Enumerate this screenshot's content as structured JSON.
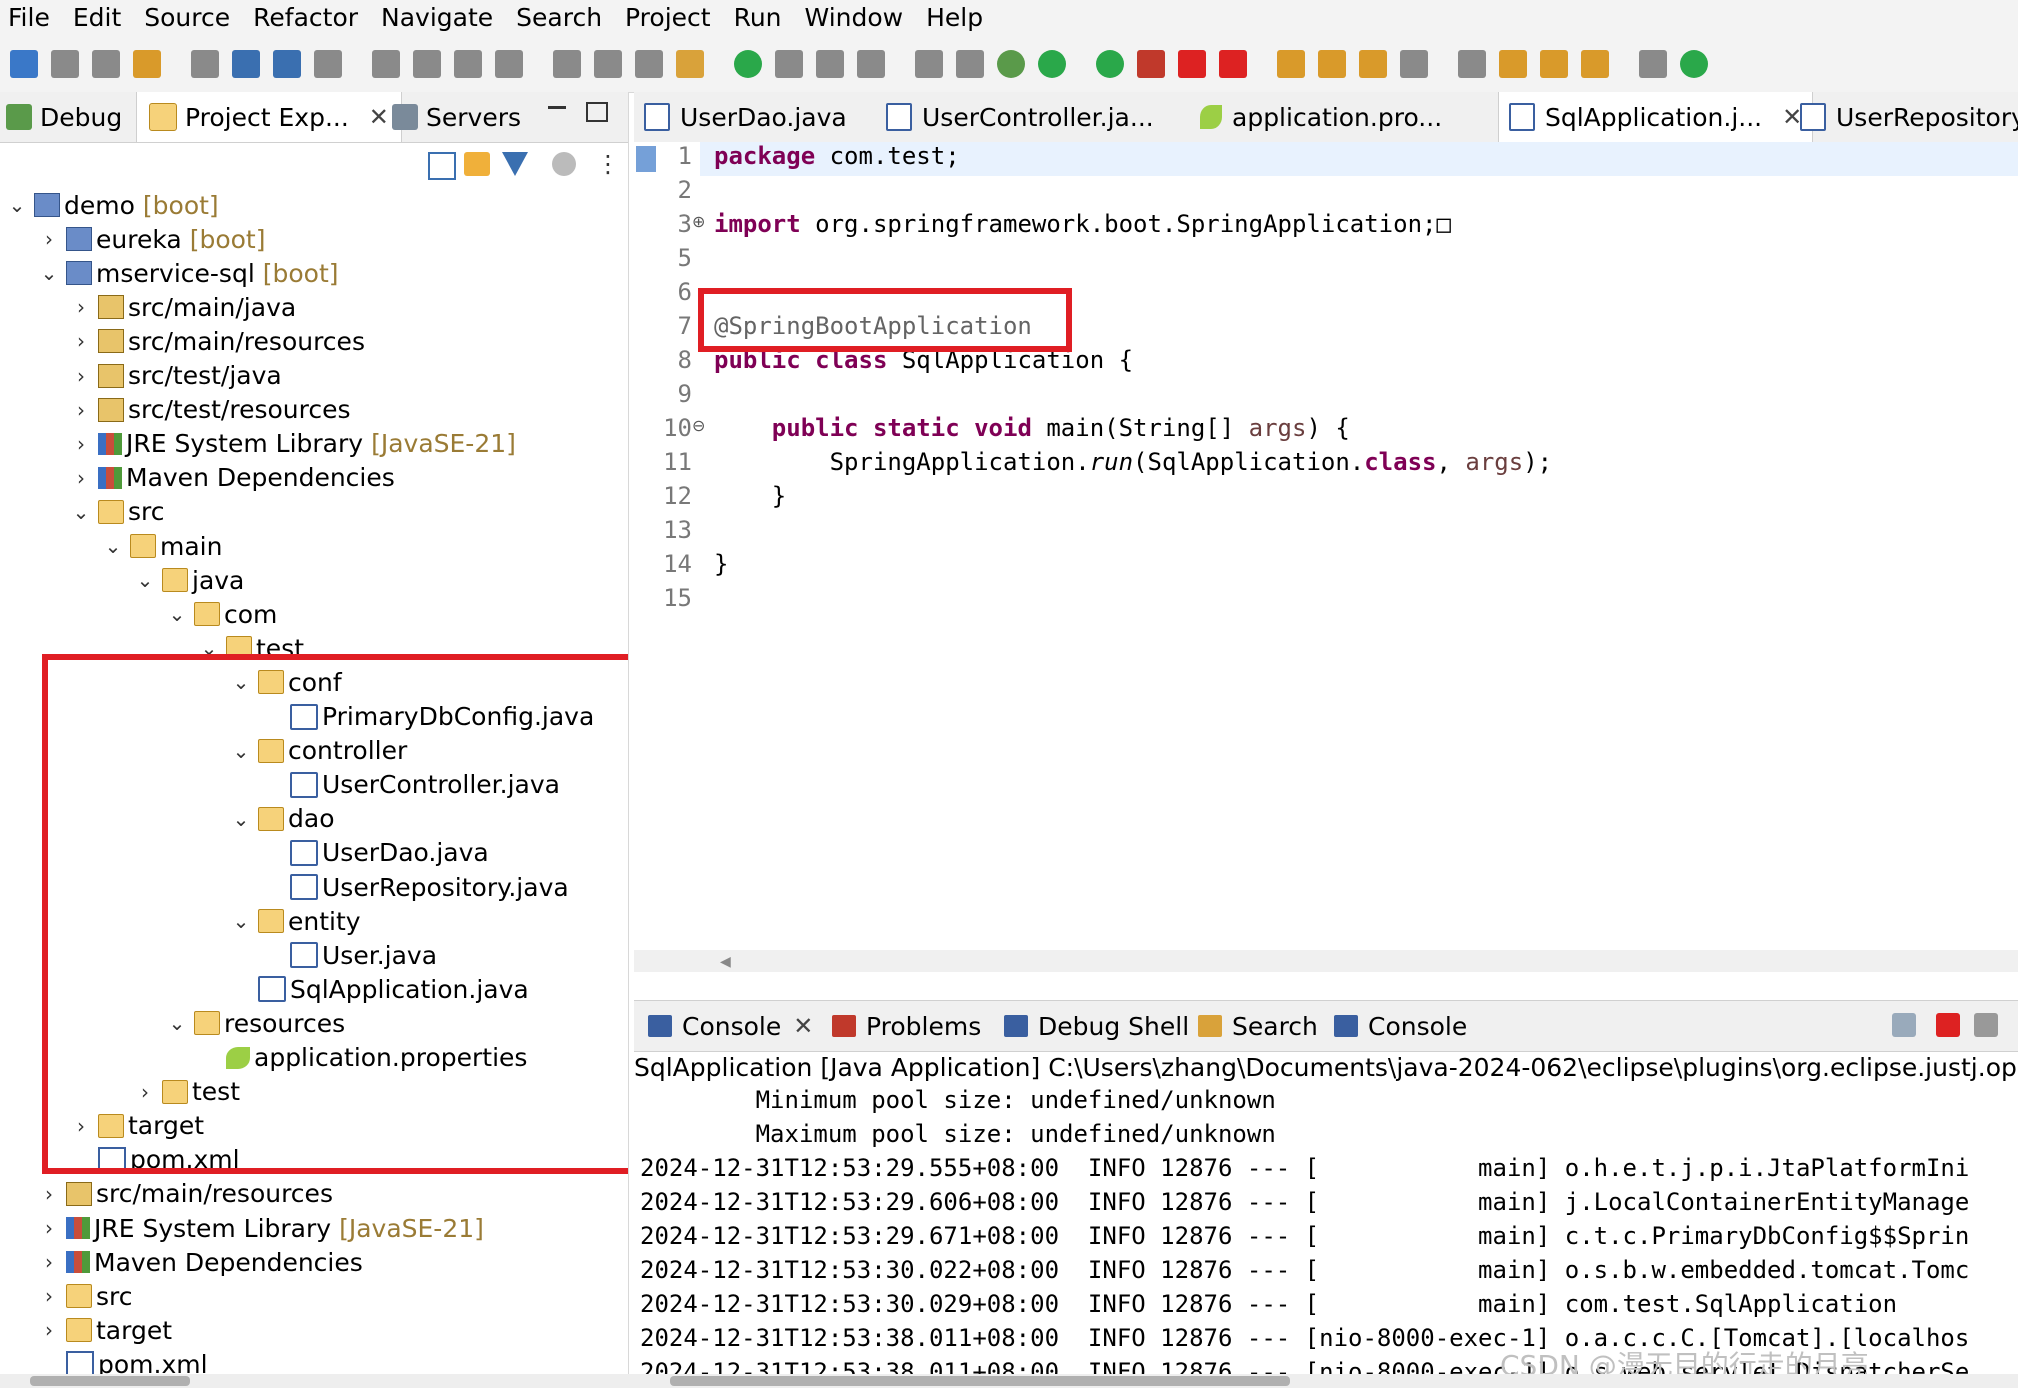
{
  "menu": [
    "File",
    "Edit",
    "Source",
    "Refactor",
    "Navigate",
    "Search",
    "Project",
    "Run",
    "Window",
    "Help"
  ],
  "left_tabs": [
    {
      "label": "Debug"
    },
    {
      "label": "Project Exp..."
    },
    {
      "label": "Servers"
    }
  ],
  "tree": [
    {
      "label": "demo",
      "deco": "[boot]",
      "icon": "ic-project",
      "expanded": true
    },
    {
      "label": "eureka",
      "deco": "[boot]",
      "icon": "ic-project",
      "expanded": false
    },
    {
      "label": "mservice-sql",
      "deco": "[boot]",
      "icon": "ic-project",
      "expanded": true
    },
    {
      "label": "src/main/java",
      "deco": "",
      "icon": "ic-pkgroot",
      "expanded": false
    },
    {
      "label": "src/main/resources",
      "deco": "",
      "icon": "ic-pkgroot",
      "expanded": false
    },
    {
      "label": "src/test/java",
      "deco": "",
      "icon": "ic-pkgroot",
      "expanded": false
    },
    {
      "label": "src/test/resources",
      "deco": "",
      "icon": "ic-pkgroot",
      "expanded": false
    },
    {
      "label": "JRE System Library",
      "deco": "[JavaSE-21]",
      "icon": "ic-lib",
      "expanded": false
    },
    {
      "label": "Maven Dependencies",
      "deco": "",
      "icon": "ic-lib",
      "expanded": false
    },
    {
      "label": "src",
      "deco": "",
      "icon": "ic-folder",
      "expanded": true
    },
    {
      "label": "main",
      "deco": "",
      "icon": "ic-folder",
      "expanded": true
    },
    {
      "label": "java",
      "deco": "",
      "icon": "ic-folder",
      "expanded": true
    },
    {
      "label": "com",
      "deco": "",
      "icon": "ic-folder",
      "expanded": true
    },
    {
      "label": "test",
      "deco": "",
      "icon": "ic-folder",
      "expanded": true
    },
    {
      "label": "conf",
      "deco": "",
      "icon": "ic-folder",
      "expanded": true
    },
    {
      "label": "PrimaryDbConfig.java",
      "deco": "",
      "icon": "ic-java",
      "expanded": null
    },
    {
      "label": "controller",
      "deco": "",
      "icon": "ic-folder",
      "expanded": true
    },
    {
      "label": "UserController.java",
      "deco": "",
      "icon": "ic-java",
      "expanded": null
    },
    {
      "label": "dao",
      "deco": "",
      "icon": "ic-folder",
      "expanded": true
    },
    {
      "label": "UserDao.java",
      "deco": "",
      "icon": "ic-java",
      "expanded": null
    },
    {
      "label": "UserRepository.java",
      "deco": "",
      "icon": "ic-java",
      "expanded": null
    },
    {
      "label": "entity",
      "deco": "",
      "icon": "ic-folder",
      "expanded": true
    },
    {
      "label": "User.java",
      "deco": "",
      "icon": "ic-java",
      "expanded": null
    },
    {
      "label": "SqlApplication.java",
      "deco": "",
      "icon": "ic-java",
      "expanded": null
    },
    {
      "label": "resources",
      "deco": "",
      "icon": "ic-folder",
      "expanded": true
    },
    {
      "label": "application.properties",
      "deco": "",
      "icon": "ic-props",
      "expanded": null
    },
    {
      "label": "test",
      "deco": "",
      "icon": "ic-folder",
      "expanded": false
    },
    {
      "label": "target",
      "deco": "",
      "icon": "ic-folder",
      "expanded": false
    },
    {
      "label": "pom.xml",
      "deco": "",
      "icon": "ic-xml",
      "expanded": null
    },
    {
      "label": "src/main/resources",
      "deco": "",
      "icon": "ic-pkgroot",
      "expanded": false
    },
    {
      "label": "JRE System Library",
      "deco": "[JavaSE-21]",
      "icon": "ic-lib",
      "expanded": false
    },
    {
      "label": "Maven Dependencies",
      "deco": "",
      "icon": "ic-lib",
      "expanded": false
    },
    {
      "label": "src",
      "deco": "",
      "icon": "ic-folder",
      "expanded": false
    },
    {
      "label": "target",
      "deco": "",
      "icon": "ic-folder",
      "expanded": false
    },
    {
      "label": "pom.xml",
      "deco": "",
      "icon": "ic-xml",
      "expanded": null
    }
  ],
  "editor_tabs": [
    {
      "label": "UserDao.java",
      "kind": "java"
    },
    {
      "label": "UserController.ja...",
      "kind": "java"
    },
    {
      "label": "application.pro...",
      "kind": "props"
    },
    {
      "label": "SqlApplication.j...",
      "kind": "java",
      "active": true
    },
    {
      "label": "UserRepository.j",
      "kind": "java"
    }
  ],
  "code_lines": [
    {
      "n": "1",
      "html": "<span class='kw'>package</span> com.test;"
    },
    {
      "n": "2",
      "html": ""
    },
    {
      "n": "3",
      "html": "<span class='kw'>import</span> org.springframework.boot.SpringApplication;&#9633;"
    },
    {
      "n": "5",
      "html": ""
    },
    {
      "n": "6",
      "html": ""
    },
    {
      "n": "7",
      "html": "<span class='ann'>@SpringBootApplication</span>"
    },
    {
      "n": "8",
      "html": "<span class='kw'>public</span> <span class='kw'>class</span> SqlApplication {"
    },
    {
      "n": "9",
      "html": ""
    },
    {
      "n": "10",
      "html": "    <span class='kw'>public</span> <span class='kw'>static</span> <span class='kw'>void</span> main(String[] <span style='color:#6a3e3e'>args</span>) {"
    },
    {
      "n": "11",
      "html": "        SpringApplication.<span class='it'>run</span>(SqlApplication.<span class='kw'>class</span>, <span style='color:#6a3e3e'>args</span>);"
    },
    {
      "n": "12",
      "html": "    }"
    },
    {
      "n": "13",
      "html": ""
    },
    {
      "n": "14",
      "html": "}"
    },
    {
      "n": "15",
      "html": ""
    }
  ],
  "console_tabs": [
    "Console",
    "Problems",
    "Debug Shell",
    "Search",
    "Console"
  ],
  "console_header": "SqlApplication [Java Application] C:\\Users\\zhang\\Documents\\java-2024-062\\eclipse\\plugins\\org.eclipse.justj.openjdk.hot",
  "console_lines": [
    "        Minimum pool size: undefined/unknown",
    "        Maximum pool size: undefined/unknown",
    "2024-12-31T12:53:29.555+08:00  INFO 12876 --- [           main] o.h.e.t.j.p.i.JtaPlatformIni",
    "2024-12-31T12:53:29.606+08:00  INFO 12876 --- [           main] j.LocalContainerEntityManage",
    "2024-12-31T12:53:29.671+08:00  INFO 12876 --- [           main] c.t.c.PrimaryDbConfig$$Sprin",
    "2024-12-31T12:53:30.022+08:00  INFO 12876 --- [           main] o.s.b.w.embedded.tomcat.Tomc",
    "2024-12-31T12:53:30.029+08:00  INFO 12876 --- [           main] com.test.SqlApplication",
    "2024-12-31T12:53:38.011+08:00  INFO 12876 --- [nio-8000-exec-1] o.a.c.c.C.[Tomcat].[localhos",
    "2024-12-31T12:53:38.011+08:00  INFO 12876 --- [nio-8000-exec-1] o.s.web.servlet.DispatcherSe"
  ],
  "watermark": "CSDN @漫无目的行走的月亮",
  "colors": {
    "highlight_box": "#e01e24",
    "keyword": "#7f0055",
    "annotation": "#646464"
  }
}
